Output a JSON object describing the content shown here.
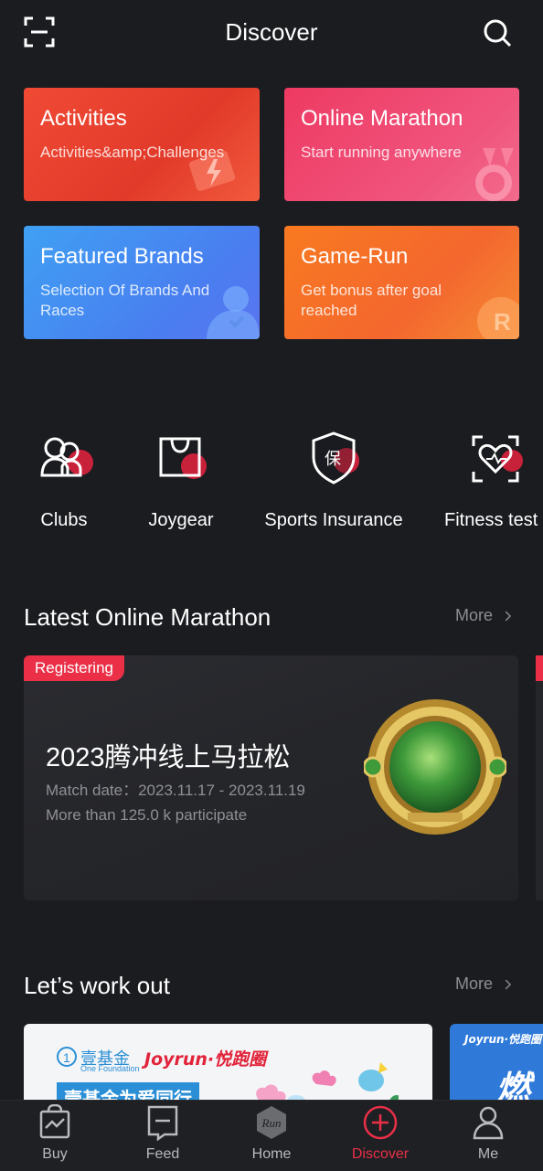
{
  "header": {
    "title": "Discover",
    "scan_icon": "scan-icon",
    "search_icon": "search-icon"
  },
  "cards": [
    {
      "title": "Activities",
      "subtitle": "Activities&amp;Challenges",
      "color": "#e9402f"
    },
    {
      "title": "Online Marathon",
      "subtitle": "Start running anywhere",
      "color": "#ee4a6e"
    },
    {
      "title": "Featured Brands",
      "subtitle": "Selection Of Brands And\nRaces",
      "color": "#4a86f1"
    },
    {
      "title": "Game-Run",
      "subtitle": "Get bonus after goal\nreached",
      "color": "#f56f2a"
    }
  ],
  "quick_links": [
    {
      "label": "Clubs",
      "icon": "clubs-icon"
    },
    {
      "label": "Joygear",
      "icon": "shopping-bag-icon"
    },
    {
      "label": "Sports Insurance",
      "icon": "insurance-shield-icon",
      "icon_glyph": "保"
    },
    {
      "label": "Fitness test",
      "icon": "fitness-heart-icon"
    }
  ],
  "marathon_section": {
    "title": "Latest Online Marathon",
    "more": "More",
    "card": {
      "badge": "Registering",
      "title": "2023腾冲线上马拉松",
      "date": "Match date：2023.11.17 - 2023.11.19",
      "participants": "More than 125.0 k participate"
    }
  },
  "workout_section": {
    "title": "Let’s work out",
    "more": "More",
    "banner1": {
      "logo_text": "壹基金",
      "logo_sub": "One Foundation",
      "brand": "Joyrun·悦跑圈",
      "headline": "壹基金为爱同行"
    },
    "banner2": {
      "brand": "Joyrun·悦跑圈",
      "headline": "燃"
    }
  },
  "tabbar": {
    "tabs": [
      {
        "label": "Buy",
        "icon": "buy-icon"
      },
      {
        "label": "Feed",
        "icon": "feed-icon"
      },
      {
        "label": "Home",
        "icon": "home-run-icon",
        "icon_text": "Run"
      },
      {
        "label": "Discover",
        "icon": "discover-icon",
        "active": true
      },
      {
        "label": "Me",
        "icon": "profile-icon"
      }
    ],
    "active_color": "#ea2f47"
  }
}
